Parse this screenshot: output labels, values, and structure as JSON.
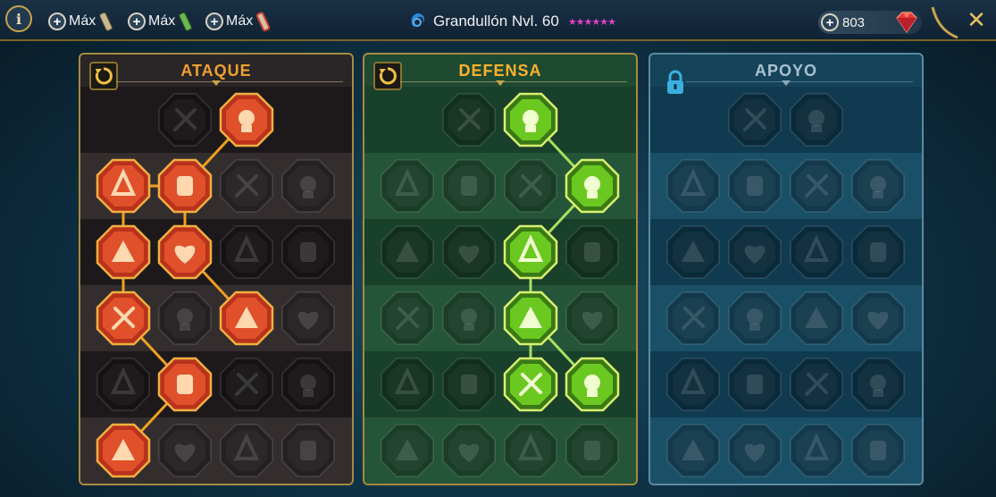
{
  "topbar": {
    "info_label": "i",
    "resources": [
      {
        "label": "Máx",
        "icon": "scroll-icon",
        "color": "#c8b890"
      },
      {
        "label": "Máx",
        "icon": "green-scroll-icon",
        "color": "#6ab850"
      },
      {
        "label": "Máx",
        "icon": "red-scroll-icon",
        "color": "#c84030"
      }
    ],
    "champion": {
      "name": "Grandullón Nvl. 60",
      "stars": "★★★★★★",
      "star_color": "#e040c8"
    },
    "gems": {
      "value": "803",
      "icon": "ruby-icon"
    },
    "close_label": "✕"
  },
  "panels": [
    {
      "key": "attack",
      "title": "ATAQUE",
      "action_icon": "reset-icon",
      "accent": "#e8462a"
    },
    {
      "key": "defense",
      "title": "DEFENSA",
      "action_icon": "reset-icon",
      "accent": "#86e030"
    },
    {
      "key": "support",
      "title": "APOYO",
      "action_icon": "lock-icon",
      "accent": "#3ab0e0"
    }
  ],
  "attack_tree": [
    [
      {
        "icon": "crossed-swords-icon",
        "active": false
      },
      {
        "icon": "blade-slash-icon",
        "active": true
      }
    ],
    [
      {
        "icon": "demon-icon",
        "active": true
      },
      {
        "icon": "triple-strike-icon",
        "active": true
      },
      {
        "icon": "shield-arrow-icon",
        "active": false
      },
      {
        "icon": "spiked-heart-icon",
        "active": false
      }
    ],
    [
      {
        "icon": "arrows-body-icon",
        "active": true
      },
      {
        "icon": "fanged-maw-icon",
        "active": true
      },
      {
        "icon": "skull-cloak-icon",
        "active": false
      },
      {
        "icon": "claw-icon",
        "active": false
      }
    ],
    [
      {
        "icon": "bleeding-heart-icon",
        "active": true
      },
      {
        "icon": "fist-icon",
        "active": false
      },
      {
        "icon": "axe-strike-icon",
        "active": true
      },
      {
        "icon": "chain-lightning-icon",
        "active": false
      }
    ],
    [
      {
        "icon": "scratch-icon",
        "active": false
      },
      {
        "icon": "skulls-icon",
        "active": true
      },
      {
        "icon": "blade-shield-icon",
        "active": false
      },
      {
        "icon": "muscle-icon",
        "active": false
      }
    ],
    [
      {
        "icon": "sword-burst-icon",
        "active": true
      },
      {
        "icon": "helmet-icon",
        "active": false
      },
      {
        "icon": "horned-head-icon",
        "active": false
      },
      {
        "icon": "warrior-skull-icon",
        "active": false
      }
    ]
  ],
  "defense_tree": [
    [
      {
        "icon": "shield-grid-icon",
        "active": false
      },
      {
        "icon": "raised-fist-icon",
        "active": true
      }
    ],
    [
      {
        "icon": "cloak-icon",
        "active": false
      },
      {
        "icon": "hand-heart-icon",
        "active": false
      },
      {
        "icon": "warrior-icon",
        "active": false
      },
      {
        "icon": "crossed-blades-icon",
        "active": true
      }
    ],
    [
      {
        "icon": "dodge-icon",
        "active": false
      },
      {
        "icon": "shield-split-icon",
        "active": false
      },
      {
        "icon": "heart-skull-icon",
        "active": true
      },
      {
        "icon": "hooded-icon",
        "active": false
      }
    ],
    [
      {
        "icon": "strong-man-icon",
        "active": false
      },
      {
        "icon": "ankh-icon",
        "active": false
      },
      {
        "icon": "open-hand-icon",
        "active": true
      },
      {
        "icon": "bull-icon",
        "active": false
      }
    ],
    [
      {
        "icon": "runner-icon",
        "active": false
      },
      {
        "icon": "spike-icon",
        "active": false
      },
      {
        "icon": "spiked-skull-icon",
        "active": true
      },
      {
        "icon": "grasp-icon",
        "active": true
      }
    ],
    [
      {
        "icon": "guardian-icon",
        "active": false
      },
      {
        "icon": "scale-shield-icon",
        "active": false
      },
      {
        "icon": "hammer-icon",
        "active": false
      },
      {
        "icon": "titan-icon",
        "active": false
      }
    ]
  ],
  "support_tree": [
    [
      {
        "icon": "heart-sparkle-icon",
        "active": false
      },
      {
        "icon": "swirl-icon",
        "active": false
      }
    ],
    [
      {
        "icon": "praying-hands-icon",
        "active": false
      },
      {
        "icon": "aura-shield-icon",
        "active": false
      },
      {
        "icon": "skull-rings-icon",
        "active": false
      },
      {
        "icon": "wind-icon",
        "active": false
      }
    ],
    [
      {
        "icon": "healer-icon",
        "active": false
      },
      {
        "icon": "lightning-shield-icon",
        "active": false
      },
      {
        "icon": "tentacles-icon",
        "active": false
      },
      {
        "icon": "figure-icon",
        "active": false
      }
    ],
    [
      {
        "icon": "chained-heart-icon",
        "active": false
      },
      {
        "icon": "meteor-icon",
        "active": false
      },
      {
        "icon": "book-icon",
        "active": false
      },
      {
        "icon": "sunburst-icon",
        "active": false
      }
    ],
    [
      {
        "icon": "compass-star-icon",
        "active": false
      },
      {
        "icon": "boot-icon",
        "active": false
      },
      {
        "icon": "eye-icon",
        "active": false
      },
      {
        "icon": "dancer-icon",
        "active": false
      }
    ],
    [
      {
        "icon": "bomb-icon",
        "active": false
      },
      {
        "icon": "death-skull-icon",
        "active": false
      },
      {
        "icon": "knight-icon",
        "active": false
      },
      {
        "icon": "eagle-icon",
        "active": false
      }
    ]
  ],
  "links": {
    "attack": [
      [
        [
          0,
          1
        ],
        [
          1,
          1
        ]
      ],
      [
        [
          1,
          0
        ],
        [
          1,
          1
        ]
      ],
      [
        [
          1,
          0
        ],
        [
          2,
          0
        ]
      ],
      [
        [
          1,
          1
        ],
        [
          2,
          1
        ]
      ],
      [
        [
          2,
          0
        ],
        [
          3,
          0
        ]
      ],
      [
        [
          2,
          1
        ],
        [
          3,
          2
        ]
      ],
      [
        [
          3,
          0
        ],
        [
          4,
          1
        ]
      ],
      [
        [
          4,
          1
        ],
        [
          5,
          0
        ]
      ]
    ],
    "defense": [
      [
        [
          0,
          1
        ],
        [
          1,
          3
        ]
      ],
      [
        [
          1,
          3
        ],
        [
          2,
          2
        ]
      ],
      [
        [
          2,
          2
        ],
        [
          3,
          2
        ]
      ],
      [
        [
          3,
          2
        ],
        [
          4,
          2
        ]
      ],
      [
        [
          3,
          2
        ],
        [
          4,
          3
        ]
      ]
    ],
    "support": []
  }
}
